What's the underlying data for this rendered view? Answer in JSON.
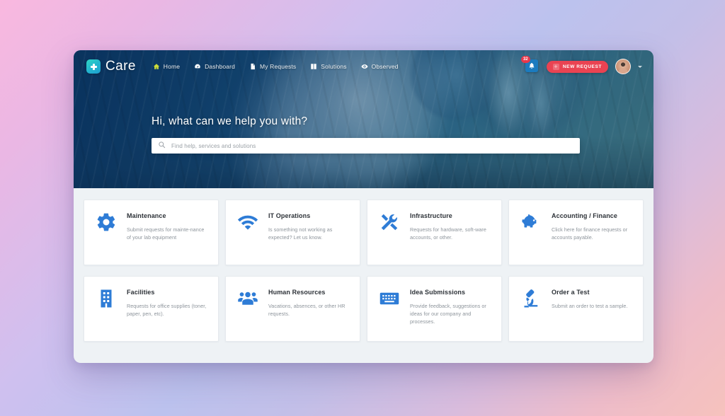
{
  "brand": {
    "name": "Care",
    "logo_icon": "medical-cross-icon",
    "accent": "#23b4cf"
  },
  "nav": {
    "items": [
      {
        "label": "Home",
        "icon": "home-icon",
        "active": true
      },
      {
        "label": "Dashboard",
        "icon": "dashboard-icon",
        "active": false
      },
      {
        "label": "My Requests",
        "icon": "document-icon",
        "active": false
      },
      {
        "label": "Solutions",
        "icon": "book-icon",
        "active": false
      },
      {
        "label": "Observed",
        "icon": "eye-icon",
        "active": false
      }
    ]
  },
  "header_actions": {
    "notifications": {
      "icon": "bell-icon",
      "badge_count": "32",
      "badge_color": "#e8374a"
    },
    "new_request": {
      "label": "NEW REQUEST",
      "icon": "plus-ticket-icon",
      "color": "#ea4352"
    },
    "avatar": {
      "name": "user-avatar"
    },
    "caret": "chevron-down-icon"
  },
  "hero": {
    "title": "Hi, what can we help you with?",
    "search": {
      "placeholder": "Find help, services and solutions",
      "value": "",
      "icon": "search-icon"
    }
  },
  "catalog": {
    "cards": [
      {
        "title": "Maintenance",
        "desc": "Submit requests for mainte-nance of your lab equipment",
        "icon": "gear-icon"
      },
      {
        "title": "IT Operations",
        "desc": "Is something not working as expected? Let us know.",
        "icon": "wifi-icon"
      },
      {
        "title": "Infrastructure",
        "desc": "Requests for hardware, soft-ware accounts, or other.",
        "icon": "tools-icon"
      },
      {
        "title": "Accounting / Finance",
        "desc": "Click here for finance requests or accounts payable.",
        "icon": "piggy-bank-icon"
      },
      {
        "title": "Facilities",
        "desc": "Requests for office supplies (toner, paper, pen, etc).",
        "icon": "building-icon"
      },
      {
        "title": "Human Resources",
        "desc": "Vacations, absences, or other HR requests.",
        "icon": "people-icon"
      },
      {
        "title": "Idea Submissions",
        "desc": "Provide feedback, suggestions or ideas for our company and processes.",
        "icon": "keyboard-icon"
      },
      {
        "title": "Order a Test",
        "desc": "Submit an order to test a sample.",
        "icon": "microscope-icon"
      }
    ]
  }
}
